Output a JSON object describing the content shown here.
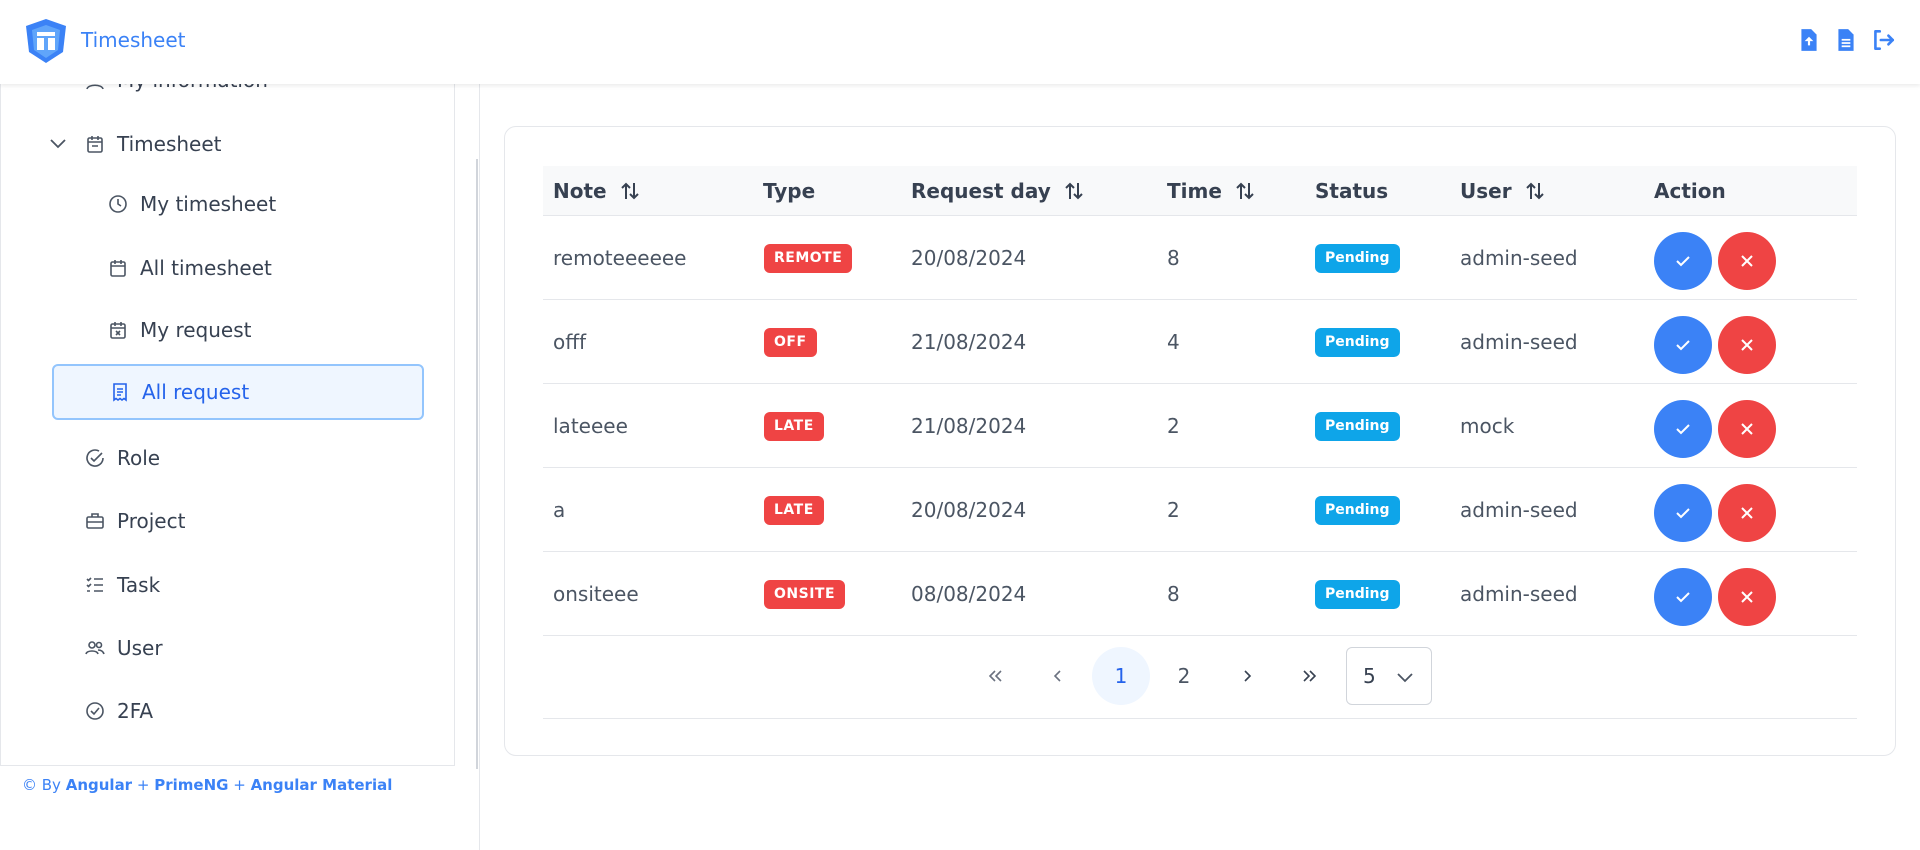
{
  "header": {
    "app_title": "Timesheet",
    "logo_icon": "shield-logo-icon",
    "actions": [
      {
        "icon": "file-upload-icon"
      },
      {
        "icon": "file-text-icon"
      },
      {
        "icon": "sign-out-icon"
      }
    ]
  },
  "sidebar": {
    "partial_item": "My information",
    "group": {
      "label": "Timesheet",
      "icon": "calendar-icon"
    },
    "sub_items": [
      {
        "label": "My timesheet",
        "icon": "clock-icon"
      },
      {
        "label": "All timesheet",
        "icon": "calendar-icon"
      },
      {
        "label": "My request",
        "icon": "calendar-x-icon"
      },
      {
        "label": "All request",
        "icon": "receipt-icon"
      }
    ],
    "items": [
      {
        "label": "Role",
        "icon": "check-circle-icon"
      },
      {
        "label": "Project",
        "icon": "briefcase-icon"
      },
      {
        "label": "Task",
        "icon": "list-check-icon"
      },
      {
        "label": "User",
        "icon": "users-icon"
      },
      {
        "label": "2FA",
        "icon": "verified-icon"
      }
    ],
    "footer": {
      "prefix": "© By",
      "a": "Angular",
      "plus1": "+",
      "b": "PrimeNG",
      "plus2": "+",
      "c": "Angular Material"
    }
  },
  "table": {
    "columns": [
      "Note",
      "Type",
      "Request day",
      "Time",
      "Status",
      "User",
      "Action"
    ],
    "rows": [
      {
        "note": "remoteeeeee",
        "type": "REMOTE",
        "day": "20/08/2024",
        "time": "8",
        "status": "Pending",
        "user": "admin-seed"
      },
      {
        "note": "offf",
        "type": "OFF",
        "day": "21/08/2024",
        "time": "4",
        "status": "Pending",
        "user": "admin-seed"
      },
      {
        "note": "lateeee",
        "type": "LATE",
        "day": "21/08/2024",
        "time": "2",
        "status": "Pending",
        "user": "mock"
      },
      {
        "note": "a",
        "type": "LATE",
        "day": "20/08/2024",
        "time": "2",
        "status": "Pending",
        "user": "admin-seed"
      },
      {
        "note": "onsiteee",
        "type": "ONSITE",
        "day": "08/08/2024",
        "time": "8",
        "status": "Pending",
        "user": "admin-seed"
      }
    ]
  },
  "paginator": {
    "pages": [
      "1",
      "2"
    ],
    "current_page": "1",
    "rows_per_page": "5"
  },
  "colors": {
    "primary": "#3b82f6",
    "danger": "#ef4444",
    "info": "#0ea5e9"
  }
}
